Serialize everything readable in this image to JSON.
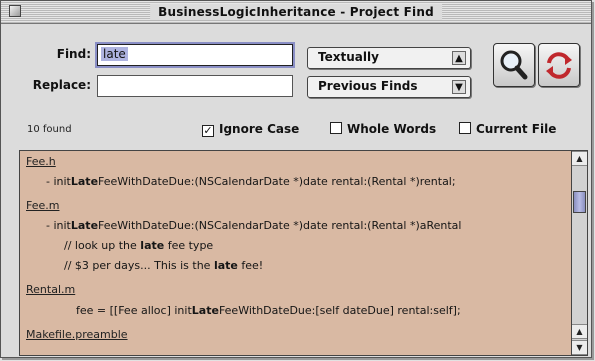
{
  "window": {
    "title": "BusinessLogicInheritance - Project Find"
  },
  "form": {
    "find_label": "Find:",
    "find_value": "late",
    "replace_label": "Replace:",
    "replace_value": "",
    "mode_popup": "Textually",
    "history_popup": "Previous Finds"
  },
  "buttons": {
    "find_icon": "magnifier-icon",
    "replace_icon": "replace-arrows-icon"
  },
  "status": {
    "found_count": "10 found"
  },
  "options": {
    "ignore_case": {
      "label": "Ignore Case",
      "checked": true
    },
    "whole_words": {
      "label": "Whole Words",
      "checked": false
    },
    "current_file": {
      "label": "Current File",
      "checked": false
    }
  },
  "results": [
    {
      "kind": "file",
      "text": "Fee.h"
    },
    {
      "kind": "match",
      "before": "- init",
      "match": "Late",
      "after": "FeeWithDateDue:(NSCalendarDate *)date rental:(Rental *)rental;"
    },
    {
      "kind": "file",
      "text": "Fee.m"
    },
    {
      "kind": "match",
      "before": "- init",
      "match": "Late",
      "after": "FeeWithDateDue:(NSCalendarDate *)date rental:(Rental *)aRental"
    },
    {
      "kind": "match",
      "before": "// look up the ",
      "match": "late",
      "after": " fee type"
    },
    {
      "kind": "match",
      "before": "// $3 per days... This is the ",
      "match": "late",
      "after": " fee!"
    },
    {
      "kind": "file",
      "text": "Rental.m"
    },
    {
      "kind": "match",
      "before": "fee = [[Fee alloc] init",
      "match": "Late",
      "after": "FeeWithDateDue:[self dateDue] rental:self];"
    },
    {
      "kind": "file",
      "text": "Makefile.preamble"
    },
    {
      "kind": "match",
      "before": "",
      "match": "",
      "after": ""
    }
  ],
  "colors": {
    "results_bg": "#d9b9a3",
    "focus_ring": "#8a8fc6",
    "replace_icon_color": "#c0282d"
  }
}
